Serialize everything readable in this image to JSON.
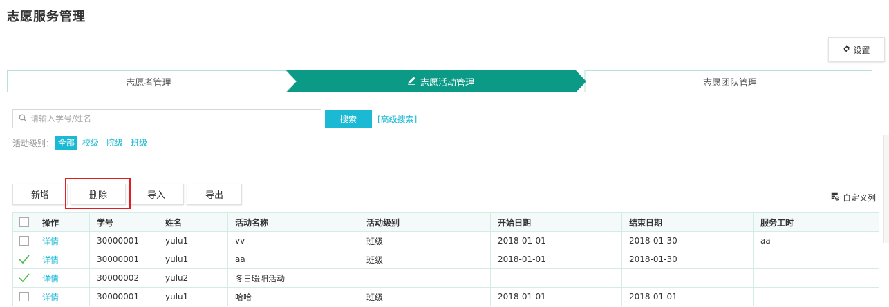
{
  "page": {
    "title": "志愿服务管理"
  },
  "settings": {
    "label": "设置",
    "icon": "gear-icon"
  },
  "steps": [
    {
      "label": "志愿者管理"
    },
    {
      "label": "志愿活动管理",
      "icon": "pencil-icon",
      "active": true
    },
    {
      "label": "志愿团队管理"
    }
  ],
  "search": {
    "placeholder": "请输入学号/姓名",
    "value": "",
    "button": "搜索",
    "advanced": "[高级搜索]"
  },
  "filter": {
    "label": "活动级别：",
    "options": [
      "全部",
      "校级",
      "院级",
      "班级"
    ],
    "selected": "全部"
  },
  "toolbar": {
    "add": "新增",
    "delete": "删除",
    "import": "导入",
    "export": "导出",
    "custom_columns": "自定义列"
  },
  "table": {
    "headers": [
      "操作",
      "学号",
      "姓名",
      "活动名称",
      "活动级别",
      "开始日期",
      "结束日期",
      "服务工时"
    ],
    "rows": [
      {
        "checked": false,
        "action": "详情",
        "id": "30000001",
        "name": "yulu1",
        "activity": "vv",
        "level": "班级",
        "start": "2018-01-01",
        "end": "2018-01-30",
        "hours": "aa"
      },
      {
        "checked": true,
        "action": "详情",
        "id": "30000001",
        "name": "yulu1",
        "activity": "aa",
        "level": "班级",
        "start": "2018-01-01",
        "end": "2018-01-30",
        "hours": ""
      },
      {
        "checked": true,
        "action": "详情",
        "id": "30000002",
        "name": "yulu2",
        "activity": "冬日暖阳活动",
        "level": "",
        "start": "",
        "end": "",
        "hours": ""
      },
      {
        "checked": false,
        "action": "详情",
        "id": "30000001",
        "name": "yulu1",
        "activity": "哈哈",
        "level": "班级",
        "start": "2018-01-01",
        "end": "2018-01-01",
        "hours": ""
      }
    ]
  },
  "colors": {
    "accent": "#1bb9d4",
    "step_active": "#0a9a86",
    "highlight": "#e02020"
  }
}
